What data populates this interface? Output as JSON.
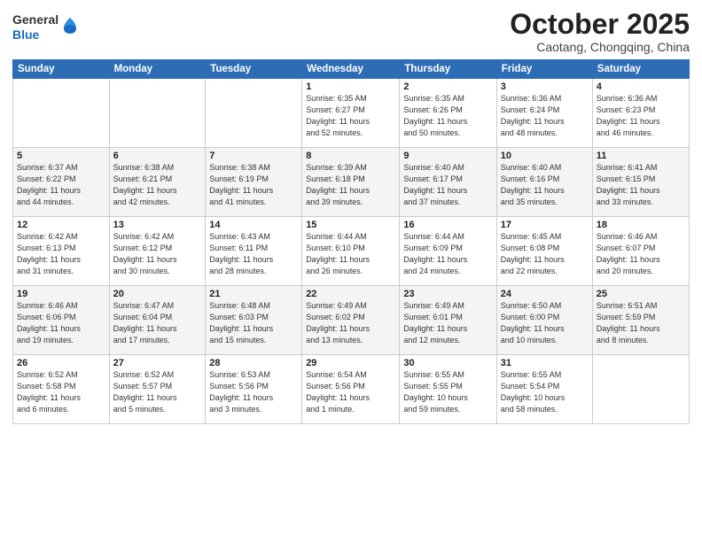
{
  "header": {
    "logo_line1": "General",
    "logo_line2": "Blue",
    "month": "October 2025",
    "location": "Caotang, Chongqing, China"
  },
  "weekdays": [
    "Sunday",
    "Monday",
    "Tuesday",
    "Wednesday",
    "Thursday",
    "Friday",
    "Saturday"
  ],
  "weeks": [
    [
      {
        "day": "",
        "info": ""
      },
      {
        "day": "",
        "info": ""
      },
      {
        "day": "",
        "info": ""
      },
      {
        "day": "1",
        "info": "Sunrise: 6:35 AM\nSunset: 6:27 PM\nDaylight: 11 hours\nand 52 minutes."
      },
      {
        "day": "2",
        "info": "Sunrise: 6:35 AM\nSunset: 6:26 PM\nDaylight: 11 hours\nand 50 minutes."
      },
      {
        "day": "3",
        "info": "Sunrise: 6:36 AM\nSunset: 6:24 PM\nDaylight: 11 hours\nand 48 minutes."
      },
      {
        "day": "4",
        "info": "Sunrise: 6:36 AM\nSunset: 6:23 PM\nDaylight: 11 hours\nand 46 minutes."
      }
    ],
    [
      {
        "day": "5",
        "info": "Sunrise: 6:37 AM\nSunset: 6:22 PM\nDaylight: 11 hours\nand 44 minutes."
      },
      {
        "day": "6",
        "info": "Sunrise: 6:38 AM\nSunset: 6:21 PM\nDaylight: 11 hours\nand 42 minutes."
      },
      {
        "day": "7",
        "info": "Sunrise: 6:38 AM\nSunset: 6:19 PM\nDaylight: 11 hours\nand 41 minutes."
      },
      {
        "day": "8",
        "info": "Sunrise: 6:39 AM\nSunset: 6:18 PM\nDaylight: 11 hours\nand 39 minutes."
      },
      {
        "day": "9",
        "info": "Sunrise: 6:40 AM\nSunset: 6:17 PM\nDaylight: 11 hours\nand 37 minutes."
      },
      {
        "day": "10",
        "info": "Sunrise: 6:40 AM\nSunset: 6:16 PM\nDaylight: 11 hours\nand 35 minutes."
      },
      {
        "day": "11",
        "info": "Sunrise: 6:41 AM\nSunset: 6:15 PM\nDaylight: 11 hours\nand 33 minutes."
      }
    ],
    [
      {
        "day": "12",
        "info": "Sunrise: 6:42 AM\nSunset: 6:13 PM\nDaylight: 11 hours\nand 31 minutes."
      },
      {
        "day": "13",
        "info": "Sunrise: 6:42 AM\nSunset: 6:12 PM\nDaylight: 11 hours\nand 30 minutes."
      },
      {
        "day": "14",
        "info": "Sunrise: 6:43 AM\nSunset: 6:11 PM\nDaylight: 11 hours\nand 28 minutes."
      },
      {
        "day": "15",
        "info": "Sunrise: 6:44 AM\nSunset: 6:10 PM\nDaylight: 11 hours\nand 26 minutes."
      },
      {
        "day": "16",
        "info": "Sunrise: 6:44 AM\nSunset: 6:09 PM\nDaylight: 11 hours\nand 24 minutes."
      },
      {
        "day": "17",
        "info": "Sunrise: 6:45 AM\nSunset: 6:08 PM\nDaylight: 11 hours\nand 22 minutes."
      },
      {
        "day": "18",
        "info": "Sunrise: 6:46 AM\nSunset: 6:07 PM\nDaylight: 11 hours\nand 20 minutes."
      }
    ],
    [
      {
        "day": "19",
        "info": "Sunrise: 6:46 AM\nSunset: 6:06 PM\nDaylight: 11 hours\nand 19 minutes."
      },
      {
        "day": "20",
        "info": "Sunrise: 6:47 AM\nSunset: 6:04 PM\nDaylight: 11 hours\nand 17 minutes."
      },
      {
        "day": "21",
        "info": "Sunrise: 6:48 AM\nSunset: 6:03 PM\nDaylight: 11 hours\nand 15 minutes."
      },
      {
        "day": "22",
        "info": "Sunrise: 6:49 AM\nSunset: 6:02 PM\nDaylight: 11 hours\nand 13 minutes."
      },
      {
        "day": "23",
        "info": "Sunrise: 6:49 AM\nSunset: 6:01 PM\nDaylight: 11 hours\nand 12 minutes."
      },
      {
        "day": "24",
        "info": "Sunrise: 6:50 AM\nSunset: 6:00 PM\nDaylight: 11 hours\nand 10 minutes."
      },
      {
        "day": "25",
        "info": "Sunrise: 6:51 AM\nSunset: 5:59 PM\nDaylight: 11 hours\nand 8 minutes."
      }
    ],
    [
      {
        "day": "26",
        "info": "Sunrise: 6:52 AM\nSunset: 5:58 PM\nDaylight: 11 hours\nand 6 minutes."
      },
      {
        "day": "27",
        "info": "Sunrise: 6:52 AM\nSunset: 5:57 PM\nDaylight: 11 hours\nand 5 minutes."
      },
      {
        "day": "28",
        "info": "Sunrise: 6:53 AM\nSunset: 5:56 PM\nDaylight: 11 hours\nand 3 minutes."
      },
      {
        "day": "29",
        "info": "Sunrise: 6:54 AM\nSunset: 5:56 PM\nDaylight: 11 hours\nand 1 minute."
      },
      {
        "day": "30",
        "info": "Sunrise: 6:55 AM\nSunset: 5:55 PM\nDaylight: 10 hours\nand 59 minutes."
      },
      {
        "day": "31",
        "info": "Sunrise: 6:55 AM\nSunset: 5:54 PM\nDaylight: 10 hours\nand 58 minutes."
      },
      {
        "day": "",
        "info": ""
      }
    ]
  ]
}
